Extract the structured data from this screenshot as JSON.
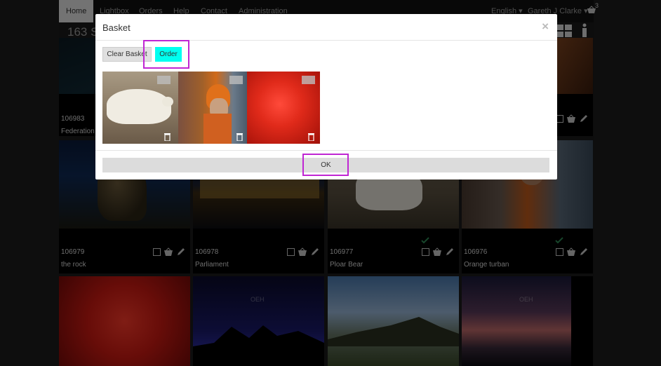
{
  "nav": {
    "items": [
      {
        "label": "Home",
        "active": true
      },
      {
        "label": "Lightbox"
      },
      {
        "label": "Orders"
      },
      {
        "label": "Help"
      },
      {
        "label": "Contact"
      },
      {
        "label": "Administration"
      }
    ],
    "language": "English ▾",
    "user": "Gareth J Clarke ▾",
    "basket_count": "3"
  },
  "results": {
    "count_label": "163 S"
  },
  "grid": {
    "row1": [
      {
        "code": "106983",
        "name": "Federation S"
      }
    ],
    "row2": [
      {
        "code": "106979",
        "name": "the rock",
        "in_basket": false
      },
      {
        "code": "106978",
        "name": "Parliament",
        "in_basket": false
      },
      {
        "code": "106977",
        "name": "Ploar Bear",
        "in_basket": true
      },
      {
        "code": "106976",
        "name": "Orange turban",
        "in_basket": true
      }
    ],
    "watermark": "OEH"
  },
  "modal": {
    "title": "Basket",
    "close": "×",
    "clear_label": "Clear Basket",
    "order_label": "Order",
    "ok_label": "OK",
    "items": [
      {
        "subject": "Polar bear"
      },
      {
        "subject": "Orange turban man"
      },
      {
        "subject": "Red carnation"
      }
    ]
  },
  "colors": {
    "accent": "#00fff0",
    "highlight": "#c026d3",
    "tick": "#2e8b57"
  }
}
